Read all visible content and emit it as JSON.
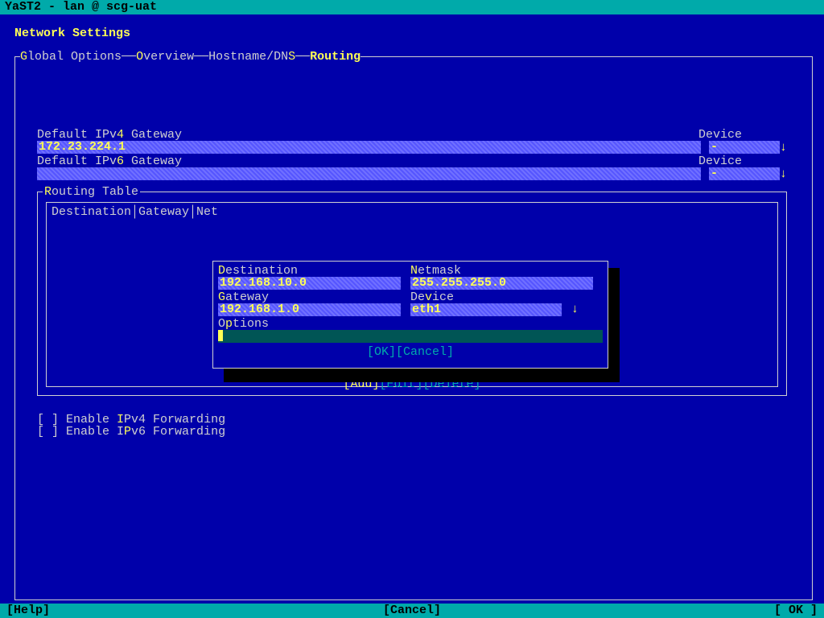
{
  "titlebar": "YaST2 - lan @ scg-uat",
  "page_title": "Network Settings",
  "tabs": {
    "global": "Global Options",
    "overview": "Overview",
    "hostname": "Hostname/DNS",
    "routing": "Routing"
  },
  "gateway": {
    "ipv4_label_pre": "Default IPv",
    "ipv4_label_hot": "4",
    "ipv4_label_post": " Gateway",
    "ipv4_value": "172.23.224.1",
    "ipv6_label_pre": "Default IPv",
    "ipv6_label_hot": "6",
    "ipv6_label_post": " Gateway",
    "ipv6_value": "",
    "device_label": "Device",
    "device4_value": "-",
    "device6_value": "-"
  },
  "routing": {
    "caption_pre": "",
    "caption_hot": "R",
    "caption_post": "outing Table",
    "columns": "Destination│Gateway│Net",
    "add": "[Add]",
    "edit": "[Edit]",
    "delete": "[Delete]"
  },
  "dialog": {
    "dest_label_hot": "D",
    "dest_label": "estination",
    "dest_value": "192.168.10.0",
    "netmask_label_hot": "N",
    "netmask_label": "etmask",
    "netmask_value": "255.255.255.0",
    "gateway_label_hot": "G",
    "gateway_label": "ateway",
    "gateway_value": "192.168.1.0",
    "device_label": "De",
    "device_label_hot": "v",
    "device_label_post": "ice",
    "device_value": "eth1",
    "options_label": "O",
    "options_label_hot": "p",
    "options_label_post": "tions",
    "ok": "[OK]",
    "cancel": "[Cancel]"
  },
  "forwarding": {
    "ipv4_pre": "[ ] Enable ",
    "ipv4_hot": "I",
    "ipv4_post": "Pv4 Forwarding",
    "ipv6_pre": "[ ] Enable I",
    "ipv6_hot": "P",
    "ipv6_post": "v6 Forwarding"
  },
  "footer": {
    "help": "[Help]",
    "cancel": "[Cancel]",
    "ok": "[ OK ]"
  }
}
